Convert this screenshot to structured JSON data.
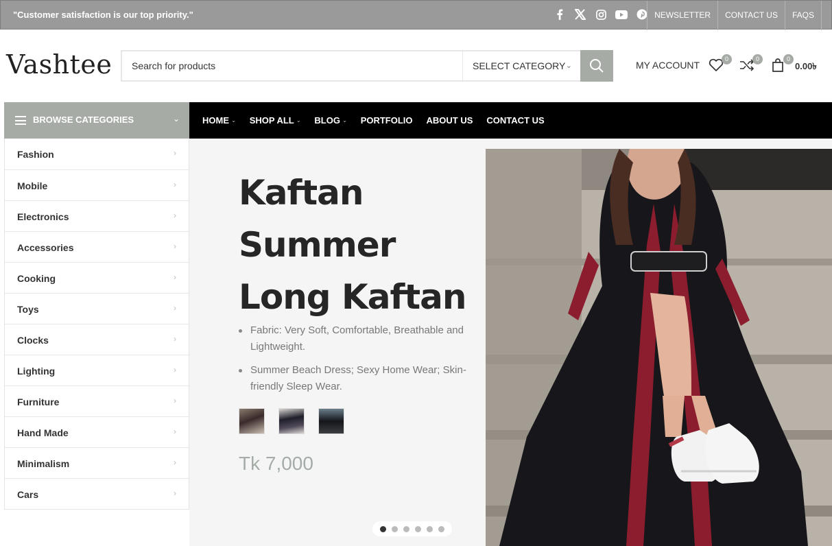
{
  "topbar": {
    "quote": "\"Customer satisfaction is our top priority.\"",
    "social_icons": [
      "facebook-icon",
      "x-icon",
      "instagram-icon",
      "youtube-icon",
      "pinterest-icon"
    ],
    "links": [
      "NEWSLETTER",
      "CONTACT US",
      "FAQS"
    ]
  },
  "header": {
    "logo": "Vashtee",
    "search_placeholder": "Search for products",
    "category_label": "SELECT CATEGORY",
    "account_label": "MY ACCOUNT",
    "wishlist_count": "0",
    "compare_count": "0",
    "cart_count": "0",
    "cart_total": "0.00৳"
  },
  "nav": {
    "browse_label": "BROWSE CATEGORIES",
    "items": [
      {
        "label": "HOME",
        "dropdown": true
      },
      {
        "label": "SHOP ALL",
        "dropdown": true
      },
      {
        "label": "BLOG",
        "dropdown": true
      },
      {
        "label": "PORTFOLIO",
        "dropdown": false
      },
      {
        "label": "ABOUT US",
        "dropdown": false
      },
      {
        "label": "CONTACT US",
        "dropdown": false
      }
    ]
  },
  "sidebar": {
    "categories": [
      "Fashion",
      "Mobile",
      "Electronics",
      "Accessories",
      "Cooking",
      "Toys",
      "Clocks",
      "Lighting",
      "Furniture",
      "Hand Made",
      "Minimalism",
      "Cars"
    ]
  },
  "hero": {
    "title_lines": [
      "Kaftan",
      "Summer",
      "Long Kaftan"
    ],
    "bullets": [
      "Fabric: Very Soft, Comfortable, Breathable and Lightweight.",
      "Summer Beach Dress; Sexy Home Wear; Skin-friendly Sleep Wear."
    ],
    "price": "Tk 7,000",
    "slide_count": 6,
    "active_slide": 1
  },
  "colors": {
    "accent": "#a6aba6",
    "topbar": "#9a9a9a",
    "nav_bg": "#000000",
    "price": "#a5aca7"
  }
}
